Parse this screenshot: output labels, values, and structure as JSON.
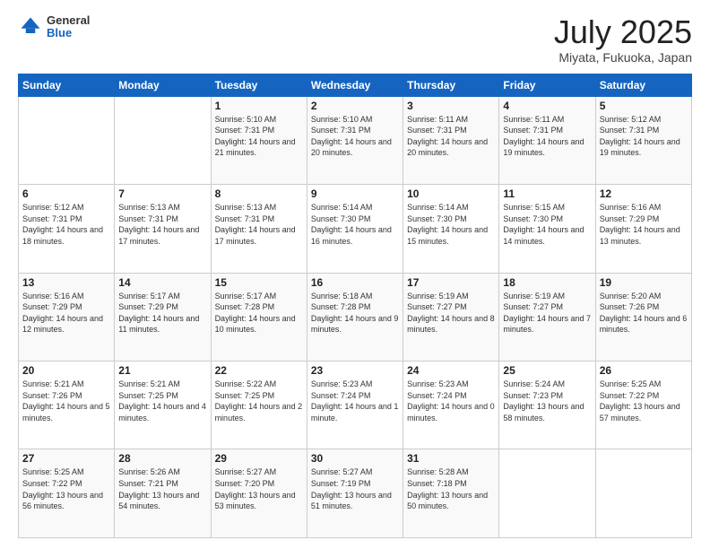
{
  "header": {
    "logo": {
      "general": "General",
      "blue": "Blue"
    },
    "title": "July 2025",
    "subtitle": "Miyata, Fukuoka, Japan"
  },
  "weekdays": [
    "Sunday",
    "Monday",
    "Tuesday",
    "Wednesday",
    "Thursday",
    "Friday",
    "Saturday"
  ],
  "weeks": [
    [
      {
        "day": null
      },
      {
        "day": null
      },
      {
        "day": "1",
        "sunrise": "Sunrise: 5:10 AM",
        "sunset": "Sunset: 7:31 PM",
        "daylight": "Daylight: 14 hours and 21 minutes."
      },
      {
        "day": "2",
        "sunrise": "Sunrise: 5:10 AM",
        "sunset": "Sunset: 7:31 PM",
        "daylight": "Daylight: 14 hours and 20 minutes."
      },
      {
        "day": "3",
        "sunrise": "Sunrise: 5:11 AM",
        "sunset": "Sunset: 7:31 PM",
        "daylight": "Daylight: 14 hours and 20 minutes."
      },
      {
        "day": "4",
        "sunrise": "Sunrise: 5:11 AM",
        "sunset": "Sunset: 7:31 PM",
        "daylight": "Daylight: 14 hours and 19 minutes."
      },
      {
        "day": "5",
        "sunrise": "Sunrise: 5:12 AM",
        "sunset": "Sunset: 7:31 PM",
        "daylight": "Daylight: 14 hours and 19 minutes."
      }
    ],
    [
      {
        "day": "6",
        "sunrise": "Sunrise: 5:12 AM",
        "sunset": "Sunset: 7:31 PM",
        "daylight": "Daylight: 14 hours and 18 minutes."
      },
      {
        "day": "7",
        "sunrise": "Sunrise: 5:13 AM",
        "sunset": "Sunset: 7:31 PM",
        "daylight": "Daylight: 14 hours and 17 minutes."
      },
      {
        "day": "8",
        "sunrise": "Sunrise: 5:13 AM",
        "sunset": "Sunset: 7:31 PM",
        "daylight": "Daylight: 14 hours and 17 minutes."
      },
      {
        "day": "9",
        "sunrise": "Sunrise: 5:14 AM",
        "sunset": "Sunset: 7:30 PM",
        "daylight": "Daylight: 14 hours and 16 minutes."
      },
      {
        "day": "10",
        "sunrise": "Sunrise: 5:14 AM",
        "sunset": "Sunset: 7:30 PM",
        "daylight": "Daylight: 14 hours and 15 minutes."
      },
      {
        "day": "11",
        "sunrise": "Sunrise: 5:15 AM",
        "sunset": "Sunset: 7:30 PM",
        "daylight": "Daylight: 14 hours and 14 minutes."
      },
      {
        "day": "12",
        "sunrise": "Sunrise: 5:16 AM",
        "sunset": "Sunset: 7:29 PM",
        "daylight": "Daylight: 14 hours and 13 minutes."
      }
    ],
    [
      {
        "day": "13",
        "sunrise": "Sunrise: 5:16 AM",
        "sunset": "Sunset: 7:29 PM",
        "daylight": "Daylight: 14 hours and 12 minutes."
      },
      {
        "day": "14",
        "sunrise": "Sunrise: 5:17 AM",
        "sunset": "Sunset: 7:29 PM",
        "daylight": "Daylight: 14 hours and 11 minutes."
      },
      {
        "day": "15",
        "sunrise": "Sunrise: 5:17 AM",
        "sunset": "Sunset: 7:28 PM",
        "daylight": "Daylight: 14 hours and 10 minutes."
      },
      {
        "day": "16",
        "sunrise": "Sunrise: 5:18 AM",
        "sunset": "Sunset: 7:28 PM",
        "daylight": "Daylight: 14 hours and 9 minutes."
      },
      {
        "day": "17",
        "sunrise": "Sunrise: 5:19 AM",
        "sunset": "Sunset: 7:27 PM",
        "daylight": "Daylight: 14 hours and 8 minutes."
      },
      {
        "day": "18",
        "sunrise": "Sunrise: 5:19 AM",
        "sunset": "Sunset: 7:27 PM",
        "daylight": "Daylight: 14 hours and 7 minutes."
      },
      {
        "day": "19",
        "sunrise": "Sunrise: 5:20 AM",
        "sunset": "Sunset: 7:26 PM",
        "daylight": "Daylight: 14 hours and 6 minutes."
      }
    ],
    [
      {
        "day": "20",
        "sunrise": "Sunrise: 5:21 AM",
        "sunset": "Sunset: 7:26 PM",
        "daylight": "Daylight: 14 hours and 5 minutes."
      },
      {
        "day": "21",
        "sunrise": "Sunrise: 5:21 AM",
        "sunset": "Sunset: 7:25 PM",
        "daylight": "Daylight: 14 hours and 4 minutes."
      },
      {
        "day": "22",
        "sunrise": "Sunrise: 5:22 AM",
        "sunset": "Sunset: 7:25 PM",
        "daylight": "Daylight: 14 hours and 2 minutes."
      },
      {
        "day": "23",
        "sunrise": "Sunrise: 5:23 AM",
        "sunset": "Sunset: 7:24 PM",
        "daylight": "Daylight: 14 hours and 1 minute."
      },
      {
        "day": "24",
        "sunrise": "Sunrise: 5:23 AM",
        "sunset": "Sunset: 7:24 PM",
        "daylight": "Daylight: 14 hours and 0 minutes."
      },
      {
        "day": "25",
        "sunrise": "Sunrise: 5:24 AM",
        "sunset": "Sunset: 7:23 PM",
        "daylight": "Daylight: 13 hours and 58 minutes."
      },
      {
        "day": "26",
        "sunrise": "Sunrise: 5:25 AM",
        "sunset": "Sunset: 7:22 PM",
        "daylight": "Daylight: 13 hours and 57 minutes."
      }
    ],
    [
      {
        "day": "27",
        "sunrise": "Sunrise: 5:25 AM",
        "sunset": "Sunset: 7:22 PM",
        "daylight": "Daylight: 13 hours and 56 minutes."
      },
      {
        "day": "28",
        "sunrise": "Sunrise: 5:26 AM",
        "sunset": "Sunset: 7:21 PM",
        "daylight": "Daylight: 13 hours and 54 minutes."
      },
      {
        "day": "29",
        "sunrise": "Sunrise: 5:27 AM",
        "sunset": "Sunset: 7:20 PM",
        "daylight": "Daylight: 13 hours and 53 minutes."
      },
      {
        "day": "30",
        "sunrise": "Sunrise: 5:27 AM",
        "sunset": "Sunset: 7:19 PM",
        "daylight": "Daylight: 13 hours and 51 minutes."
      },
      {
        "day": "31",
        "sunrise": "Sunrise: 5:28 AM",
        "sunset": "Sunset: 7:18 PM",
        "daylight": "Daylight: 13 hours and 50 minutes."
      },
      {
        "day": null
      },
      {
        "day": null
      }
    ]
  ]
}
